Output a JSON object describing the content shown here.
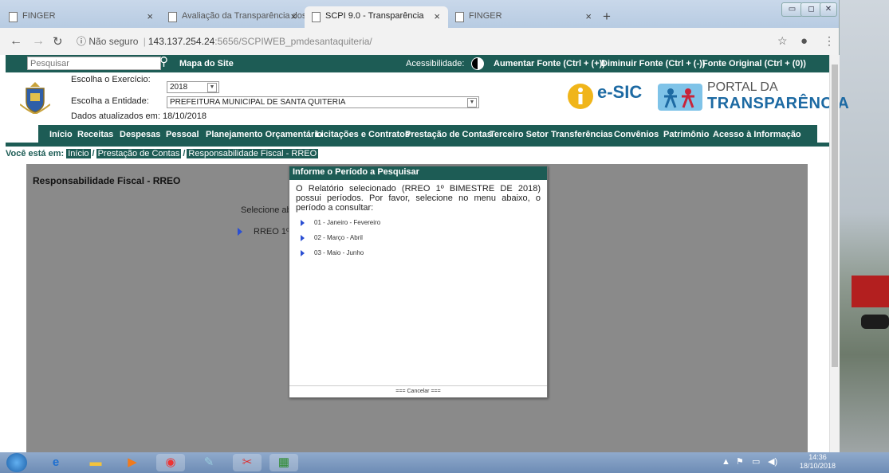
{
  "browser": {
    "tabs": [
      {
        "title": "FINGER"
      },
      {
        "title": "Avaliação da Transparência dos"
      },
      {
        "title": "SCPI 9.0 - Transparência"
      },
      {
        "title": "FINGER"
      }
    ],
    "address": {
      "security": "Não seguro",
      "host": "143.137.254.24",
      "path": ":5656/SCPIWEB_pmdesantaquiteria/"
    }
  },
  "topbar": {
    "search_placeholder": "Pesquisar",
    "site_map": "Mapa do Site",
    "accessibility": "Acessibilidade:",
    "increase_font": "Aumentar Fonte (Ctrl + (+))",
    "decrease_font": "Diminuir Fonte (Ctrl + (-))",
    "original_font": "Fonte Original (Ctrl + (0))"
  },
  "header": {
    "exercise_label": "Escolha o Exercício:",
    "exercise_value": "2018",
    "entity_label": "Escolha a Entidade:",
    "entity_value": "PREFEITURA MUNICIPAL DE SANTA QUITERIA",
    "updated": "Dados atualizados em: 18/10/2018",
    "esic": "e-SIC",
    "portal_line1": "PORTAL DA",
    "portal_line2": "TRANSPARÊNCIA"
  },
  "menu": [
    "Início",
    "Receitas",
    "Despesas",
    "Pessoal",
    "Planejamento Orçamentário",
    "Licitações e Contratos",
    "Prestação de Contas",
    "Terceiro Setor",
    "Transferências",
    "Convênios",
    "Patrimônio",
    "Acesso à Informação"
  ],
  "breadcrumb": {
    "label": "Você está em:",
    "items": [
      "Início",
      "Prestação de Contas",
      "Responsabilidade Fiscal - RREO"
    ]
  },
  "page": {
    "title": "Responsabilidade Fiscal - RREO",
    "select_text": "Selecione aba",
    "item": "RREO 1º"
  },
  "dialog": {
    "title": "Informe o Período a Pesquisar",
    "message": "O Relatório selecionado (RREO 1º BIMESTRE DE 2018) possui períodos. Por favor, selecione no menu abaixo, o período a consultar:",
    "options": [
      "01 - Janeiro - Fevereiro",
      "02 - Março - Abril",
      "03 - Maio - Junho"
    ],
    "cancel": "=== Cancelar ==="
  },
  "taskbar": {
    "time": "14:36",
    "date": "18/10/2018"
  },
  "colors": {
    "brand": "#1d5c55",
    "overlay": "#8a8a8a",
    "bullet": "#2b4fd3"
  }
}
